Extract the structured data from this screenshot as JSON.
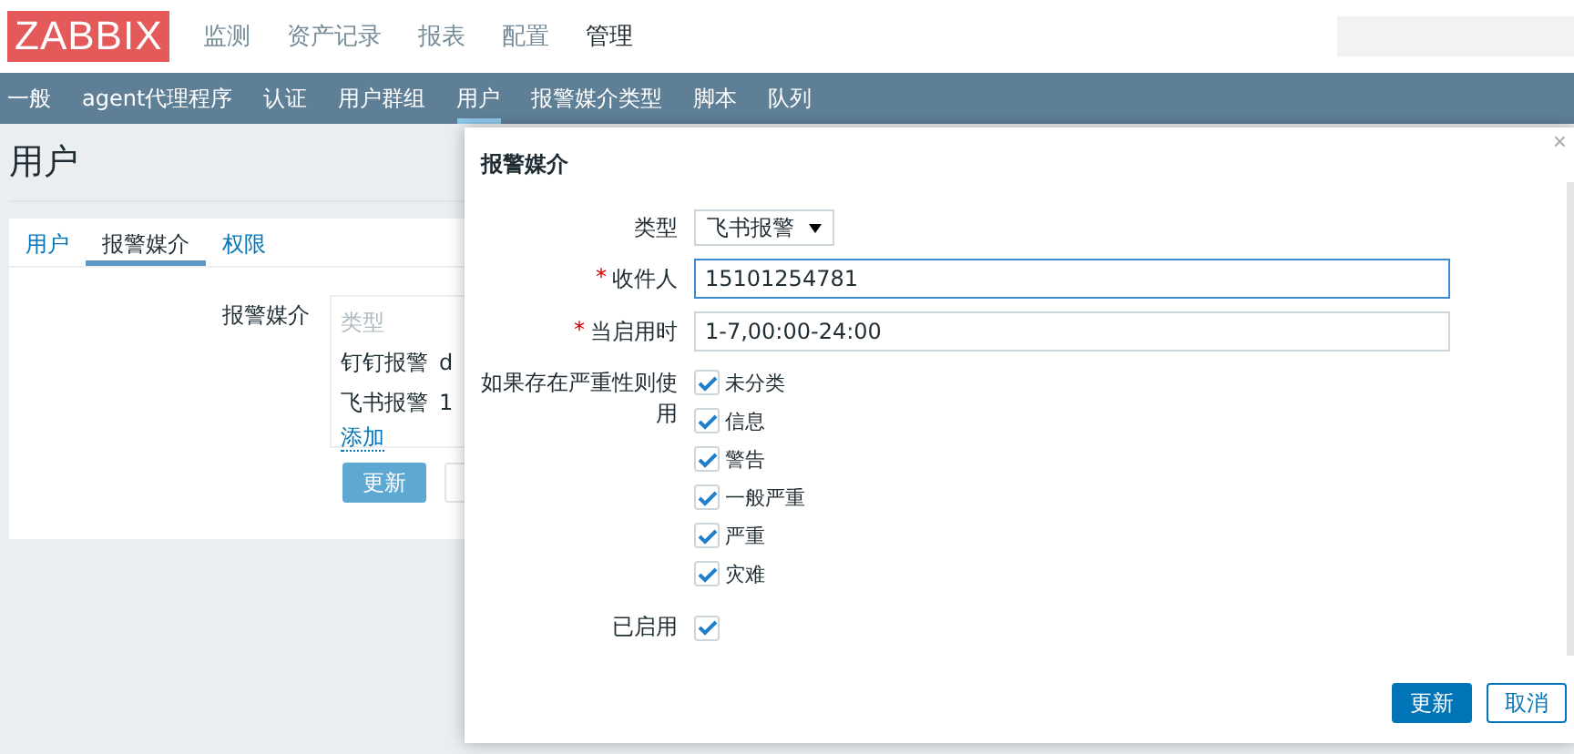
{
  "header": {
    "logo": "ZABBIX",
    "menu": [
      {
        "label": "监测",
        "selected": false
      },
      {
        "label": "资产记录",
        "selected": false
      },
      {
        "label": "报表",
        "selected": false
      },
      {
        "label": "配置",
        "selected": false
      },
      {
        "label": "管理",
        "selected": true
      }
    ]
  },
  "subnav": [
    {
      "label": "一般",
      "selected": false
    },
    {
      "label": "agent代理程序",
      "selected": false
    },
    {
      "label": "认证",
      "selected": false
    },
    {
      "label": "用户群组",
      "selected": false
    },
    {
      "label": "用户",
      "selected": true
    },
    {
      "label": "报警媒介类型",
      "selected": false
    },
    {
      "label": "脚本",
      "selected": false
    },
    {
      "label": "队列",
      "selected": false
    }
  ],
  "page": {
    "title": "用户",
    "tabs": [
      {
        "label": "用户",
        "selected": false
      },
      {
        "label": "报警媒介",
        "selected": true
      },
      {
        "label": "权限",
        "selected": false
      }
    ],
    "media": {
      "label": "报警媒介",
      "column_1": "类型",
      "rows": [
        {
          "type": "钉钉报警",
          "column_2": "d"
        },
        {
          "type": "飞书报警",
          "column_2": "1"
        }
      ],
      "add_link": "添加"
    },
    "buttons": [
      {
        "label": "更新",
        "kind": "primary"
      },
      {
        "kind": "disabled"
      }
    ]
  },
  "dialog": {
    "title": "报警媒介",
    "close": "×",
    "fields": [
      {
        "label": "类型",
        "kind": "select",
        "value": "飞书报警"
      },
      {
        "label": "收件人",
        "kind": "input",
        "value": "15101254781",
        "mark": "*",
        "focused": true
      },
      {
        "label": "当启用时",
        "kind": "input",
        "value": "1-7,00:00-24:00",
        "mark": "*",
        "focused": false
      }
    ],
    "severity": {
      "label": "如果存在严重性则使用",
      "options": [
        {
          "label": "未分类",
          "checked": true
        },
        {
          "label": "信息",
          "checked": true
        },
        {
          "label": "警告",
          "checked": true
        },
        {
          "label": "一般严重",
          "checked": true
        },
        {
          "label": "严重",
          "checked": true
        },
        {
          "label": "灾难",
          "checked": true
        }
      ]
    },
    "enabled": {
      "label": "已启用",
      "checked": true
    },
    "buttons": [
      {
        "label": "更新",
        "kind": "primary"
      },
      {
        "label": "取消",
        "kind": "secondary"
      }
    ]
  }
}
